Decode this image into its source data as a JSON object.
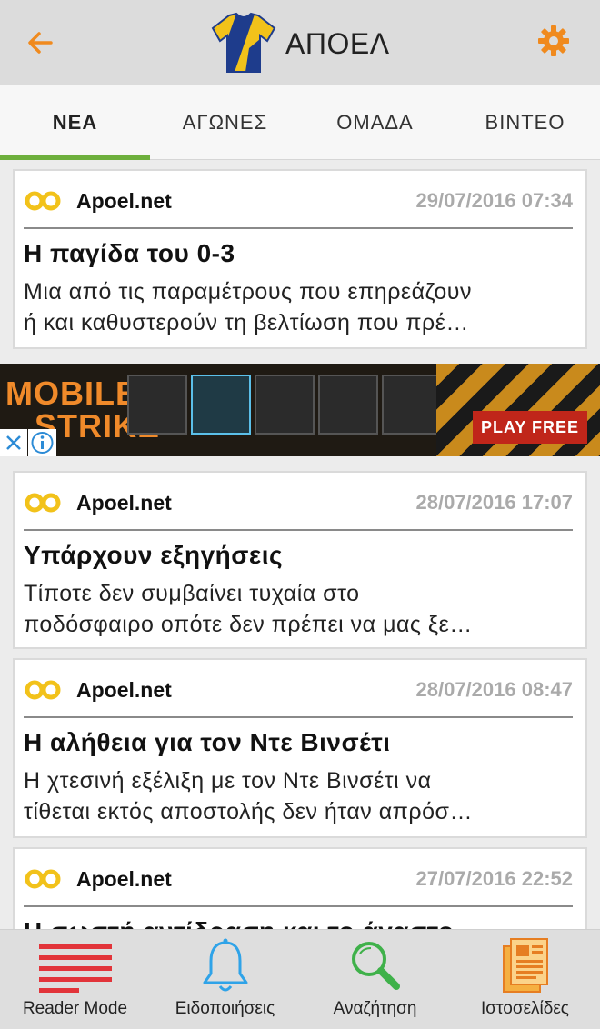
{
  "header": {
    "title": "ΑΠΟΕΛ"
  },
  "tabs": [
    {
      "label": "ΝΕΑ",
      "active": true
    },
    {
      "label": "ΑΓΩΝΕΣ",
      "active": false
    },
    {
      "label": "ΟΜΑΔΑ",
      "active": false
    },
    {
      "label": "ΒΙΝΤΕΟ",
      "active": false
    }
  ],
  "ad": {
    "brand_line1": "MOBILE",
    "brand_line2": "STRIKE",
    "cta": "PLAY FREE"
  },
  "articles": [
    {
      "source": "Apoel.net",
      "date": "29/07/2016 07:34",
      "title": "Η παγίδα του 0-3",
      "excerpt_line1": "Μια από τις παραμέτρους που επηρεάζουν",
      "excerpt_line2": "ή και καθυστερούν τη βελτίωση που πρέ…"
    },
    {
      "source": "Apoel.net",
      "date": "28/07/2016 17:07",
      "title": "Υπάρχουν εξηγήσεις",
      "excerpt_line1": "Τίποτε δεν συμβαίνει τυχαία στο",
      "excerpt_line2": "ποδόσφαιρο οπότε δεν πρέπει να μας ξε…"
    },
    {
      "source": "Apoel.net",
      "date": "28/07/2016 08:47",
      "title": "Η αλήθεια για τον Ντε Βινσέτι",
      "excerpt_line1": "Η χτεσινή εξέλιξη με τον Ντε Βινσέτι να",
      "excerpt_line2": "τίθεται εκτός αποστολής δεν ήταν απρόσ…"
    },
    {
      "source": "Apoel.net",
      "date": "27/07/2016 22:52",
      "title": "Η σωστή αντίδραση και το άγαστο"
    }
  ],
  "bottom_nav": [
    {
      "label": "Reader Mode",
      "icon": "reader-mode-icon"
    },
    {
      "label": "Ειδοποιήσεις",
      "icon": "bell-icon"
    },
    {
      "label": "Αναζήτηση",
      "icon": "search-icon"
    },
    {
      "label": "Ιστοσελίδες",
      "icon": "websites-icon"
    }
  ],
  "colors": {
    "accent_orange": "#f08a1e",
    "tab_indicator": "#6daf3c",
    "date_gray": "#aaaaaa"
  }
}
